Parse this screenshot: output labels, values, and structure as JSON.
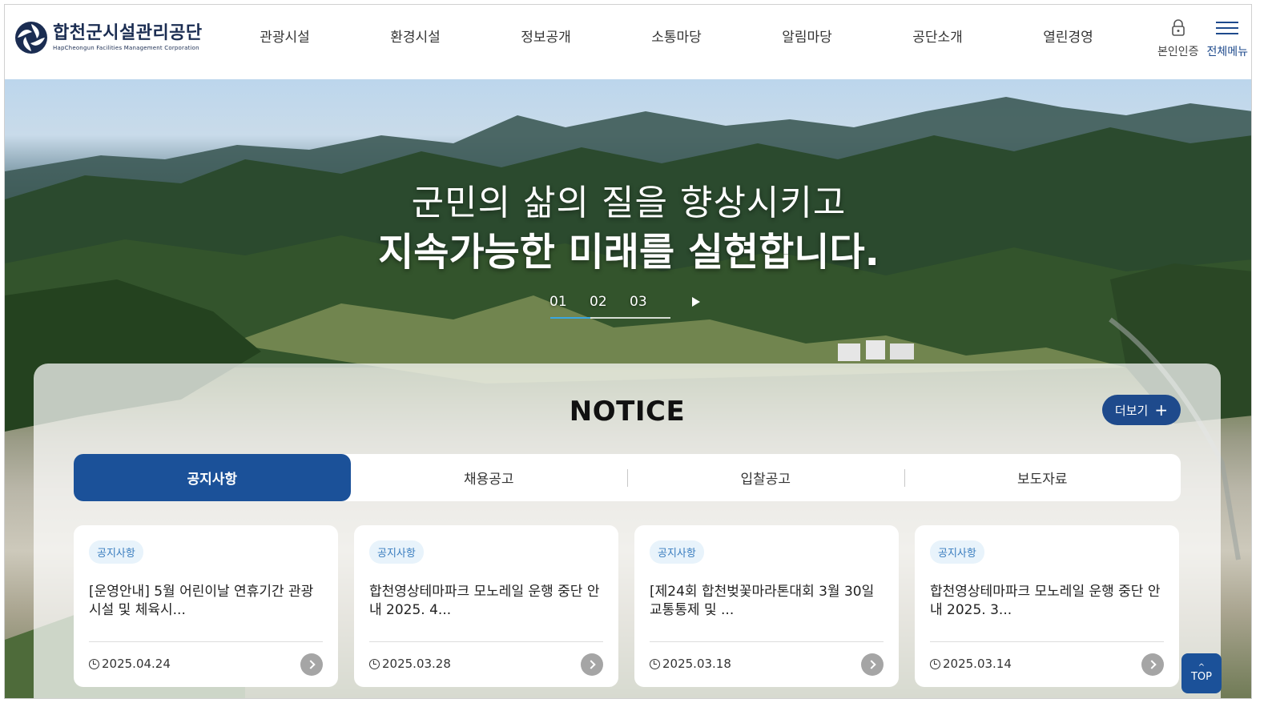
{
  "header": {
    "logo_title": "합천군시설관리공단",
    "logo_subtitle": "HapCheongun Facilities Management Corporation",
    "nav": [
      "관광시설",
      "환경시설",
      "정보공개",
      "소통마당",
      "알림마당",
      "공단소개",
      "열린경영"
    ],
    "auth_label": "본인인증",
    "menu_label": "전체메뉴"
  },
  "hero": {
    "line1": "군민의 삶의 질을 향상시키고",
    "line2": "지속가능한 미래를 실현합니다.",
    "slides": [
      "01",
      "02",
      "03"
    ],
    "progress_fraction": 0.33
  },
  "notice": {
    "title": "NOTICE",
    "more_label": "더보기",
    "tabs": [
      "공지사항",
      "채용공고",
      "입찰공고",
      "보도자료"
    ],
    "cards": [
      {
        "badge": "공지사항",
        "title": "[운영안내] 5월 어린이날 연휴기간 관광시설 및 체육시...",
        "date": "2025.04.24"
      },
      {
        "badge": "공지사항",
        "title": "합천영상테마파크 모노레일 운행 중단 안내 2025. 4...",
        "date": "2025.03.28"
      },
      {
        "badge": "공지사항",
        "title": "[제24회 합천벚꽃마라톤대회 3월 30일 교통통제 및 ...",
        "date": "2025.03.18"
      },
      {
        "badge": "공지사항",
        "title": "합천영상테마파크 모노레일 운행 중단 안내 2025. 3...",
        "date": "2025.03.14"
      }
    ]
  },
  "top_button": "TOP",
  "colors": {
    "brand": "#1e4a8c",
    "tab_active": "#1b5199",
    "slider_progress": "#3aa7e0"
  }
}
